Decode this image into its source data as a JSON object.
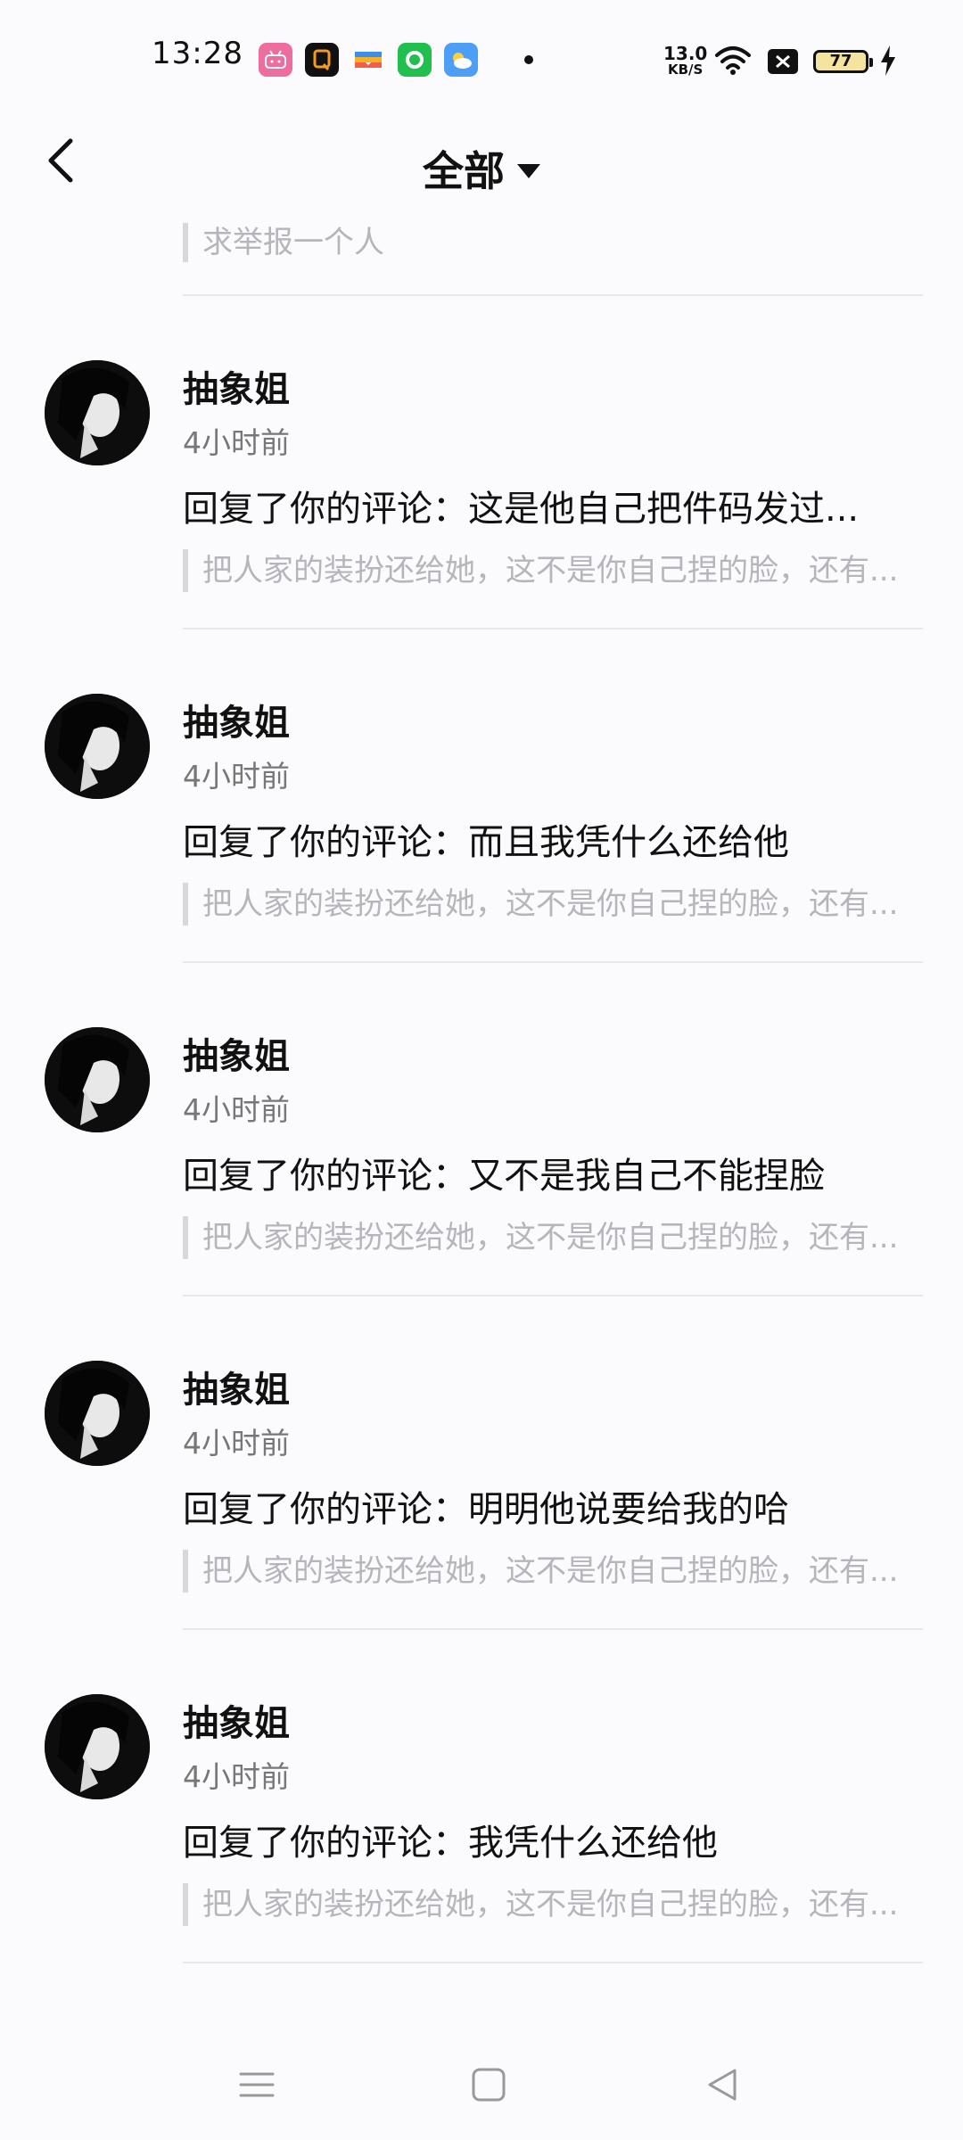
{
  "status_bar": {
    "time": "13:28",
    "net_speed_value": "13.0",
    "net_speed_unit": "KB/S",
    "battery": "77",
    "app_icons": [
      "bilibili-icon",
      "app-q-icon",
      "wallet-icon",
      "green-app-icon",
      "weather-icon"
    ]
  },
  "header": {
    "title": "全部",
    "back_icon": "chevron-left-icon",
    "dropdown_icon": "caret-down-icon"
  },
  "top_partial_quote": "求举报一个人",
  "notifications": [
    {
      "name": "抽象姐",
      "time": "4小时前",
      "reply": "回复了你的评论：这是他自己把件码发过...",
      "quote": "把人家的装扮还给她，这不是你自己捏的脸，还有..."
    },
    {
      "name": "抽象姐",
      "time": "4小时前",
      "reply": "回复了你的评论：而且我凭什么还给他",
      "quote": "把人家的装扮还给她，这不是你自己捏的脸，还有..."
    },
    {
      "name": "抽象姐",
      "time": "4小时前",
      "reply": "回复了你的评论：又不是我自己不能捏脸",
      "quote": "把人家的装扮还给她，这不是你自己捏的脸，还有..."
    },
    {
      "name": "抽象姐",
      "time": "4小时前",
      "reply": "回复了你的评论：明明他说要给我的哈",
      "quote": "把人家的装扮还给她，这不是你自己捏的脸，还有..."
    },
    {
      "name": "抽象姐",
      "time": "4小时前",
      "reply": "回复了你的评论：我凭什么还给他",
      "quote": "把人家的装扮还给她，这不是你自己捏的脸，还有..."
    }
  ],
  "nav_bar": {
    "menu_icon": "menu-icon",
    "home_icon": "home-square-icon",
    "back_icon": "back-triangle-icon"
  }
}
